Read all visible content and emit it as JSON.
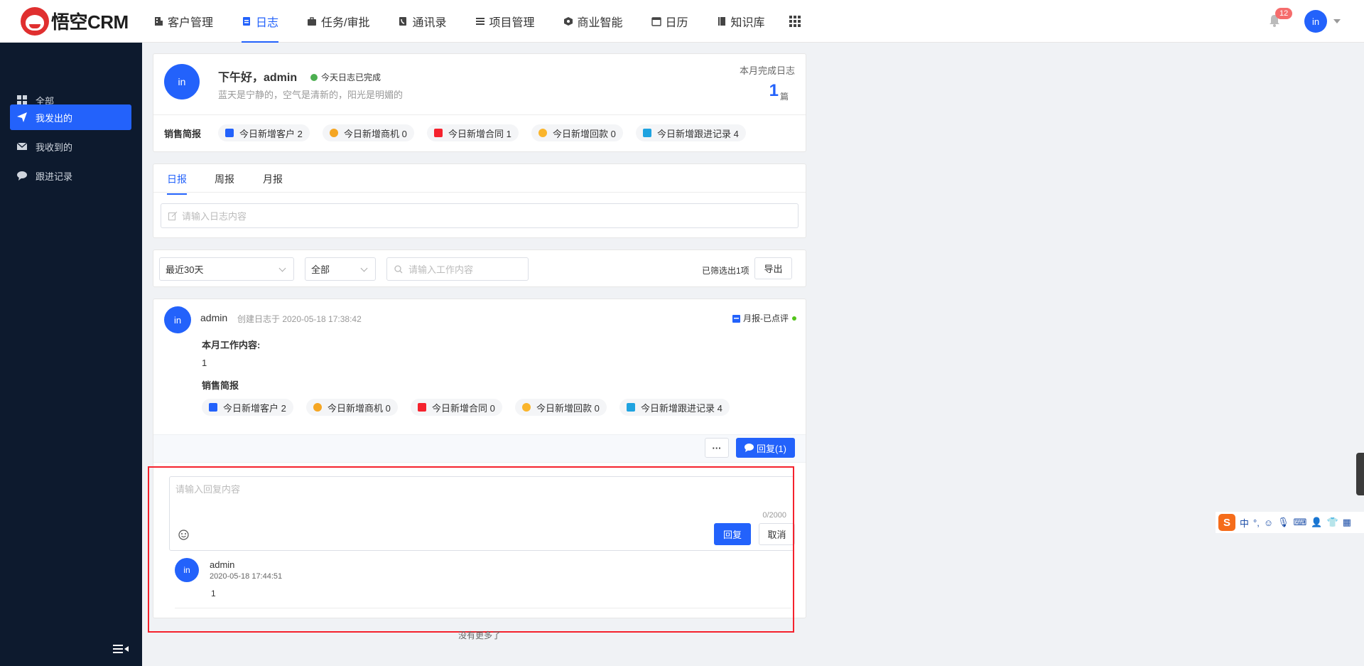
{
  "app": {
    "logo_text": "悟空CRM",
    "notification_count": "12",
    "user_avatar": "in"
  },
  "nav": [
    {
      "label": "客户管理",
      "icon": "building-icon"
    },
    {
      "label": "日志",
      "icon": "log-icon",
      "active": true
    },
    {
      "label": "任务/审批",
      "icon": "briefcase-icon"
    },
    {
      "label": "通讯录",
      "icon": "phone-book-icon"
    },
    {
      "label": "项目管理",
      "icon": "project-icon"
    },
    {
      "label": "商业智能",
      "icon": "bi-icon"
    },
    {
      "label": "日历",
      "icon": "calendar-icon"
    },
    {
      "label": "知识库",
      "icon": "book-icon"
    }
  ],
  "sidebar": {
    "items": [
      {
        "label": "全部",
        "icon": "grid-icon"
      },
      {
        "label": "我发出的",
        "icon": "send-icon",
        "active": true
      },
      {
        "label": "我收到的",
        "icon": "mail-icon"
      },
      {
        "label": "跟进记录",
        "icon": "chat-icon"
      }
    ]
  },
  "header_card": {
    "avatar": "in",
    "greeting": "下午好，admin",
    "status": "今天日志已完成",
    "motto": "蓝天是宁静的，空气是清新的，阳光是明媚的",
    "month_label": "本月完成日志",
    "month_count": "1",
    "month_unit": "篇",
    "sales_title": "销售简报",
    "stats": [
      "今日新增客户 2",
      "今日新增商机 0",
      "今日新增合同 1",
      "今日新增回款 0",
      "今日新增跟进记录 4"
    ]
  },
  "editor_card": {
    "tabs": [
      "日报",
      "周报",
      "月报"
    ],
    "active_tab": "日报",
    "placeholder": "请输入日志内容"
  },
  "filter_bar": {
    "range": "最近30天",
    "scope": "全部",
    "search_placeholder": "请输入工作内容",
    "result_text": "已筛选出1项",
    "export_label": "导出"
  },
  "entry": {
    "avatar": "in",
    "author": "admin",
    "created": "创建日志于 2020-05-18 17:38:42",
    "type": "月报-已点评",
    "content_title": "本月工作内容:",
    "content": "1",
    "sales_title": "销售简报",
    "stats": [
      "今日新增客户 2",
      "今日新增商机 0",
      "今日新增合同 0",
      "今日新增回款 0",
      "今日新增跟进记录 4"
    ],
    "more_label": "···",
    "reply_label": "回复(1)"
  },
  "reply": {
    "placeholder": "请输入回复内容",
    "counter": "0/2000",
    "submit_label": "回复",
    "cancel_label": "取消",
    "comment": {
      "avatar": "in",
      "author": "admin",
      "time": "2020-05-18 17:44:51",
      "text": "1"
    }
  },
  "footer": {
    "no_more": "没有更多了"
  },
  "ime": {
    "logo": "S",
    "mode": "中"
  },
  "colors": {
    "primary": "#2362fb",
    "sidebar_bg": "#0d1a2e",
    "highlight": "#f5222d"
  }
}
